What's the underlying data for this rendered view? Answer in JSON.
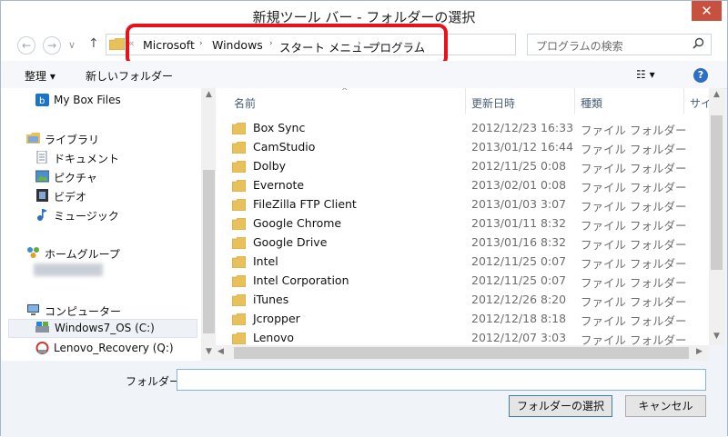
{
  "window": {
    "title": "新規ツール バー - フォルダーの選択",
    "close_label": "✕"
  },
  "nav": {
    "back": "←",
    "forward": "→",
    "up": "↑",
    "dropdown": "∨",
    "overflow": "«",
    "breadcrumbs": [
      "Microsoft",
      "Windows",
      "スタート メニュー",
      "プログラム"
    ],
    "separator": "›",
    "refresh": "↻"
  },
  "search": {
    "placeholder": "プログラムの検索"
  },
  "toolbar": {
    "organize": "整理 ▾",
    "new_folder": "新しいフォルダー",
    "view": "☷ ▾",
    "help": "?"
  },
  "sidebar": {
    "items": [
      {
        "label": "My Box Files",
        "icon": "box-icon"
      },
      {
        "label": "ライブラリ",
        "icon": "library-icon"
      },
      {
        "label": "ドキュメント",
        "icon": "document-icon"
      },
      {
        "label": "ピクチャ",
        "icon": "picture-icon"
      },
      {
        "label": "ビデオ",
        "icon": "video-icon"
      },
      {
        "label": "ミュージック",
        "icon": "music-icon"
      },
      {
        "label": "ホームグループ",
        "icon": "homegroup-icon"
      },
      {
        "label": "コンピューター",
        "icon": "computer-icon"
      },
      {
        "label": "Windows7_OS (C:)",
        "icon": "drive-icon"
      },
      {
        "label": "Lenovo_Recovery (Q:)",
        "icon": "recovery-drive-icon"
      }
    ]
  },
  "columns": {
    "name": "名前",
    "date": "更新日時",
    "type": "種類",
    "size": "サイ"
  },
  "files": [
    {
      "name": "Box Sync",
      "date": "2012/12/23 16:33",
      "type": "ファイル フォルダー"
    },
    {
      "name": "CamStudio",
      "date": "2013/01/12 16:44",
      "type": "ファイル フォルダー"
    },
    {
      "name": "Dolby",
      "date": "2012/11/25 0:08",
      "type": "ファイル フォルダー"
    },
    {
      "name": "Evernote",
      "date": "2013/02/01 0:08",
      "type": "ファイル フォルダー"
    },
    {
      "name": "FileZilla FTP Client",
      "date": "2013/01/03 3:07",
      "type": "ファイル フォルダー"
    },
    {
      "name": "Google Chrome",
      "date": "2013/01/11 8:32",
      "type": "ファイル フォルダー"
    },
    {
      "name": "Google Drive",
      "date": "2013/01/16 8:32",
      "type": "ファイル フォルダー"
    },
    {
      "name": "Intel",
      "date": "2012/11/25 0:07",
      "type": "ファイル フォルダー"
    },
    {
      "name": "Intel Corporation",
      "date": "2012/11/25 0:07",
      "type": "ファイル フォルダー"
    },
    {
      "name": "iTunes",
      "date": "2012/12/26 8:20",
      "type": "ファイル フォルダー"
    },
    {
      "name": "Jcropper",
      "date": "2012/12/18 8:18",
      "type": "ファイル フォルダー"
    },
    {
      "name": "Lenovo",
      "date": "2012/12/07 3:03",
      "type": "ファイル フォルダー"
    }
  ],
  "footer": {
    "folder_label": "フォルダー:",
    "folder_value": "",
    "select_button": "フォルダーの選択",
    "cancel_button": "キャンセル"
  },
  "colors": {
    "highlight": "#e8121c",
    "folder": "#e8c15a",
    "close": "#c7503f"
  }
}
